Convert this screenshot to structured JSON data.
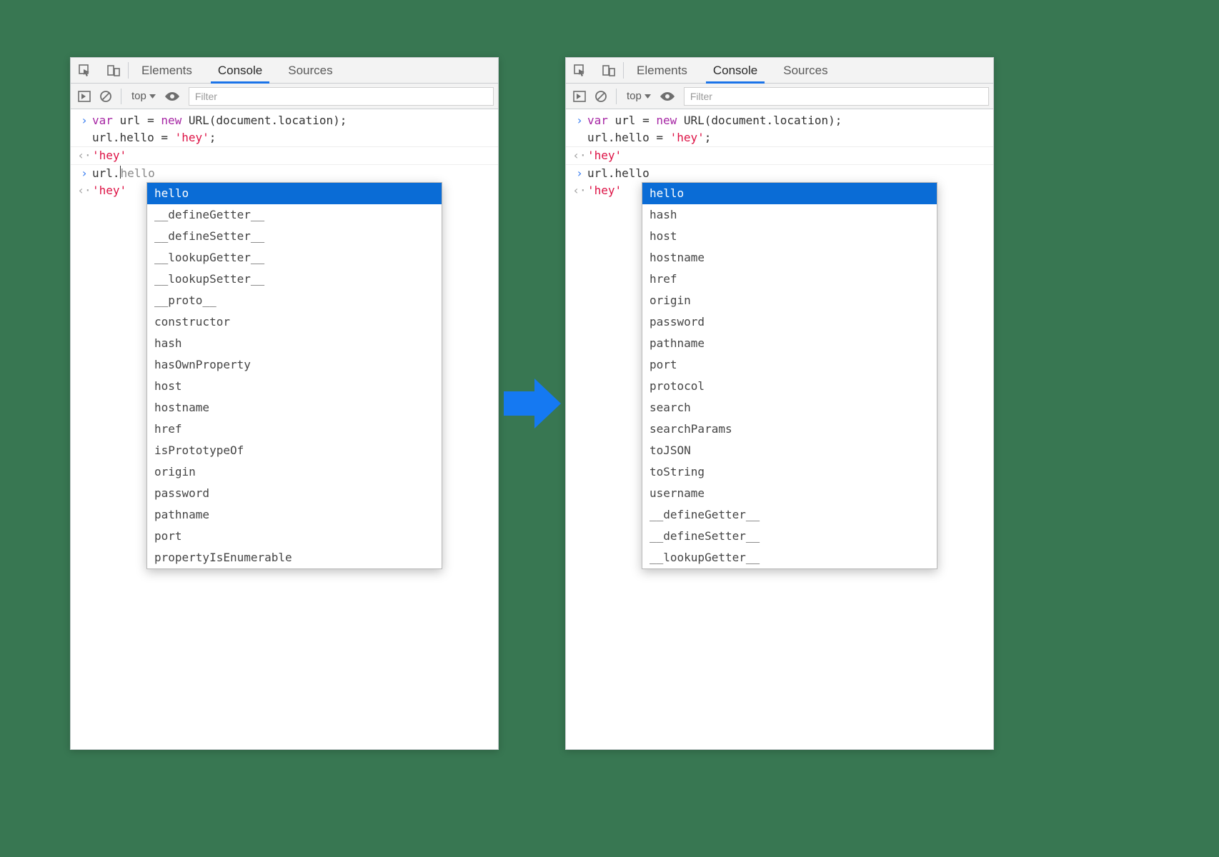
{
  "tabs": {
    "elements": "Elements",
    "console": "Console",
    "sources": "Sources"
  },
  "toolbar": {
    "context": "top",
    "filter_placeholder": "Filter"
  },
  "code": {
    "line1_var": "var",
    "line1_mid": " url = ",
    "line1_new": "new",
    "line1_rest": " URL(document.location);",
    "line2": "url.hello = ",
    "line2_str": "'hey'",
    "line2_semi": ";",
    "result1": "'hey'",
    "prompt_left": "url.",
    "prompt_after_caret": "hello",
    "prompt_right": "url.hello",
    "result2": "'hey'"
  },
  "suggestions_left": [
    "hello",
    "__defineGetter__",
    "__defineSetter__",
    "__lookupGetter__",
    "__lookupSetter__",
    "__proto__",
    "constructor",
    "hash",
    "hasOwnProperty",
    "host",
    "hostname",
    "href",
    "isPrototypeOf",
    "origin",
    "password",
    "pathname",
    "port",
    "propertyIsEnumerable"
  ],
  "suggestions_right": [
    "hello",
    "hash",
    "host",
    "hostname",
    "href",
    "origin",
    "password",
    "pathname",
    "port",
    "protocol",
    "search",
    "searchParams",
    "toJSON",
    "toString",
    "username",
    "__defineGetter__",
    "__defineSetter__",
    "__lookupGetter__"
  ]
}
